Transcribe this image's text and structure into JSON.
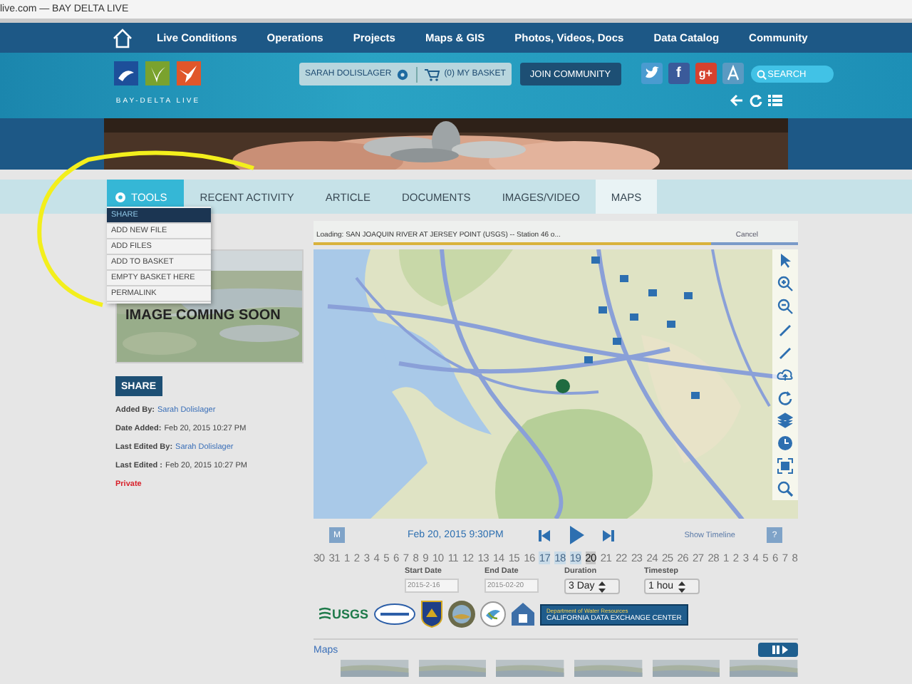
{
  "browser": {
    "tab_text": "live.com — BAY DELTA LIVE"
  },
  "nav": [
    "Live Conditions",
    "Operations",
    "Projects",
    "Maps & GIS",
    "Photos, Videos, Docs",
    "Data Catalog",
    "Community"
  ],
  "logo": {
    "caption": "BAY-DELTA LIVE"
  },
  "user": {
    "name": "SARAH DOLISLAGER",
    "basket": "(0) MY BASKET"
  },
  "join_button": "JOIN COMMUNITY",
  "social": [
    {
      "kind": "twitter"
    },
    {
      "kind": "facebook",
      "glyph": "f"
    },
    {
      "kind": "googleplus",
      "glyph": "g+"
    },
    {
      "kind": "app"
    }
  ],
  "search": {
    "placeholder": "SEARCH"
  },
  "tools_menu": {
    "label": "TOOLS",
    "expanded": true,
    "items": [
      {
        "label": "SHARE",
        "selected": true
      },
      {
        "label": "ADD NEW FILE",
        "selected": false
      },
      {
        "label": "ADD FILES",
        "selected": false
      },
      {
        "label": "ADD TO BASKET",
        "selected": false
      },
      {
        "label": "EMPTY BASKET HERE",
        "selected": false
      },
      {
        "label": "PERMALINK",
        "selected": false
      }
    ]
  },
  "tabs": [
    {
      "label": "RECENT ACTIVITY",
      "selected": false
    },
    {
      "label": "ARTICLE",
      "selected": false
    },
    {
      "label": "DOCUMENTS",
      "selected": false
    },
    {
      "label": "IMAGES/VIDEO",
      "selected": false
    },
    {
      "label": "MAPS",
      "selected": true
    }
  ],
  "side": {
    "image_caption": "IMAGE COMING SOON",
    "share_button": "SHARE",
    "meta": [
      {
        "label": "Added By:",
        "value": "Sarah Dolislager",
        "kind": "link"
      },
      {
        "label": "Date Added:",
        "value": "Feb 20, 2015 10:27 PM",
        "kind": "text"
      },
      {
        "label": "Last Edited By:",
        "value": "Sarah Dolislager",
        "kind": "link"
      },
      {
        "label": "Last Edited :",
        "value": "Feb 20, 2015 10:27 PM",
        "kind": "text"
      }
    ],
    "privacy": "Private"
  },
  "loading": {
    "text": "Loading: SAN JOAQUIN RIVER AT JERSEY POINT (USGS) -- Station 46 o...",
    "cancel": "Cancel",
    "level": 0.82
  },
  "player": {
    "mode_button": "M",
    "datetime": "Feb 20, 2015 9:30PM",
    "show_timeline": "Show Timeline",
    "help": "?"
  },
  "timeline": {
    "days": [
      {
        "label": "30",
        "selected": false
      },
      {
        "label": "31",
        "selected": false
      },
      {
        "label": "1",
        "selected": false
      },
      {
        "label": "2",
        "selected": false
      },
      {
        "label": "3",
        "selected": false
      },
      {
        "label": "4",
        "selected": false
      },
      {
        "label": "5",
        "selected": false
      },
      {
        "label": "6",
        "selected": false
      },
      {
        "label": "7",
        "selected": false
      },
      {
        "label": "8",
        "selected": false
      },
      {
        "label": "9",
        "selected": false
      },
      {
        "label": "10",
        "selected": false
      },
      {
        "label": "11",
        "selected": false
      },
      {
        "label": "12",
        "selected": false
      },
      {
        "label": "13",
        "selected": false
      },
      {
        "label": "14",
        "selected": false
      },
      {
        "label": "15",
        "selected": false
      },
      {
        "label": "16",
        "selected": false
      },
      {
        "label": "17",
        "selected": true
      },
      {
        "label": "18",
        "selected": true
      },
      {
        "label": "19",
        "selected": true
      },
      {
        "label": "20",
        "selected": true
      },
      {
        "label": "21",
        "selected": false
      },
      {
        "label": "22",
        "selected": false
      },
      {
        "label": "23",
        "selected": false
      },
      {
        "label": "24",
        "selected": false
      },
      {
        "label": "25",
        "selected": false
      },
      {
        "label": "26",
        "selected": false
      },
      {
        "label": "27",
        "selected": false
      },
      {
        "label": "28",
        "selected": false
      },
      {
        "label": "1",
        "selected": false
      },
      {
        "label": "2",
        "selected": false
      },
      {
        "label": "3",
        "selected": false
      },
      {
        "label": "4",
        "selected": false
      },
      {
        "label": "5",
        "selected": false
      },
      {
        "label": "6",
        "selected": false
      },
      {
        "label": "7",
        "selected": false
      },
      {
        "label": "8",
        "selected": false
      }
    ]
  },
  "filters": [
    {
      "label": "Start Date",
      "kind": "date",
      "value": "2015-2-16"
    },
    {
      "label": "End Date",
      "kind": "date",
      "value": "2015-02-20"
    },
    {
      "label": "Duration",
      "kind": "select",
      "value": "3 Day"
    },
    {
      "label": "Timestep",
      "kind": "select",
      "value": "1 hou"
    }
  ],
  "partners": [
    {
      "kind": "usgs",
      "text": "USGS"
    },
    {
      "kind": "oval"
    },
    {
      "kind": "shield"
    },
    {
      "kind": "seal"
    },
    {
      "kind": "bird"
    },
    {
      "kind": "house"
    },
    {
      "kind": "banner",
      "lines": [
        "Department of Water Resources",
        "CALIFORNIA DATA EXCHANGE CENTER"
      ]
    }
  ],
  "maps_section": {
    "title": "Maps"
  },
  "annotation": {
    "kind": "ellipse"
  }
}
